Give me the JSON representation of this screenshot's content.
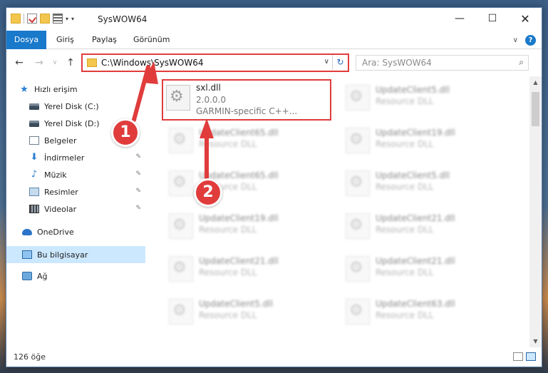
{
  "window": {
    "title": "SysWOW64",
    "minimize": "—",
    "maximize": "☐",
    "close": "✕"
  },
  "ribbon": {
    "tabs": [
      "Dosya",
      "Giriş",
      "Paylaş",
      "Görünüm"
    ],
    "help": "?"
  },
  "nav": {
    "back": "←",
    "forward": "→",
    "up": "↑",
    "address": "C:\\Windows\\SysWOW64",
    "dropdown": "∨",
    "refresh": "↻"
  },
  "search": {
    "placeholder": "Ara: SysWOW64",
    "icon": "⌕"
  },
  "sidebar": {
    "items": [
      {
        "label": "Hızlı erişim",
        "icon": "star-icon"
      },
      {
        "label": "Yerel Disk (C:)",
        "icon": "disk-icon"
      },
      {
        "label": "Yerel Disk (D:)",
        "icon": "disk-icon"
      },
      {
        "label": "Belgeler",
        "icon": "document-icon"
      },
      {
        "label": "İndirmeler",
        "icon": "download-icon"
      },
      {
        "label": "Müzik",
        "icon": "music-icon"
      },
      {
        "label": "Resimler",
        "icon": "pictures-icon"
      },
      {
        "label": "Videolar",
        "icon": "video-icon"
      },
      {
        "label": "OneDrive",
        "icon": "cloud-icon"
      },
      {
        "label": "Bu bilgisayar",
        "icon": "computer-icon"
      },
      {
        "label": "Ağ",
        "icon": "network-icon"
      }
    ]
  },
  "files": {
    "selected": {
      "name": "sxl.dll",
      "version": "2.0.0.0",
      "description": "GARMIN-specific C++..."
    },
    "left": [
      {
        "name": "UpdateClient65.dll",
        "description": "Resource DLL"
      },
      {
        "name": "UpdateClient65.dll",
        "description": "Resource DLL"
      },
      {
        "name": "UpdateClient19.dll",
        "description": "Resource DLL"
      },
      {
        "name": "UpdateClient21.dll",
        "description": "Resource DLL"
      },
      {
        "name": "UpdateClient5.dll",
        "description": "Resource DLL"
      }
    ],
    "right": [
      {
        "name": "UpdateClient5.dll",
        "description": "Resource DLL"
      },
      {
        "name": "UpdateClient19.dll",
        "description": "Resource DLL"
      },
      {
        "name": "UpdateClient5.dll",
        "description": "Resource DLL"
      },
      {
        "name": "UpdateClient21.dll",
        "description": "Resource DLL"
      },
      {
        "name": "UpdateClient21.dll",
        "description": "Resource DLL"
      },
      {
        "name": "UpdateClient63.dll",
        "description": "Resource DLL"
      }
    ]
  },
  "status": {
    "count": "126 öğe"
  },
  "annotations": {
    "step1": "1",
    "step2": "2",
    "color": "#e03c3c"
  }
}
